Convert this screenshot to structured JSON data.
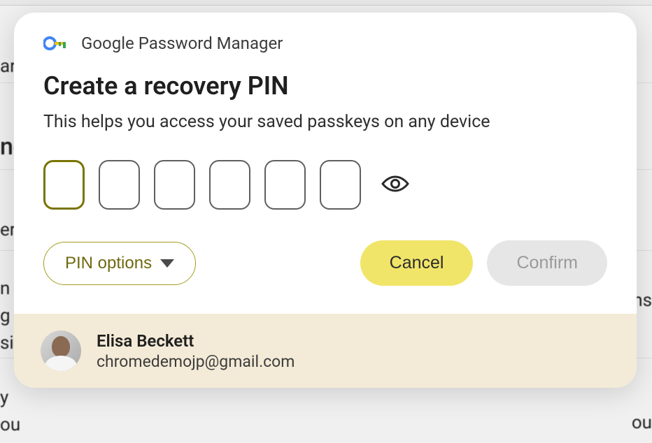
{
  "dialog": {
    "app_title": "Google Password Manager",
    "heading": "Create a recovery PIN",
    "subheading": "This helps you access your saved passkeys on any device",
    "pin_length": 6,
    "pin_options_label": "PIN options",
    "cancel_label": "Cancel",
    "confirm_label": "Confirm"
  },
  "user": {
    "name": "Elisa Beckett",
    "email": "chromedemojp@gmail.com"
  },
  "background": {
    "t1": "ar",
    "t2": "ng",
    "t3": "er",
    "t4": "n i\ng\nsi",
    "t5": "ns",
    "t6": " y\nou",
    "t7": "ou"
  }
}
